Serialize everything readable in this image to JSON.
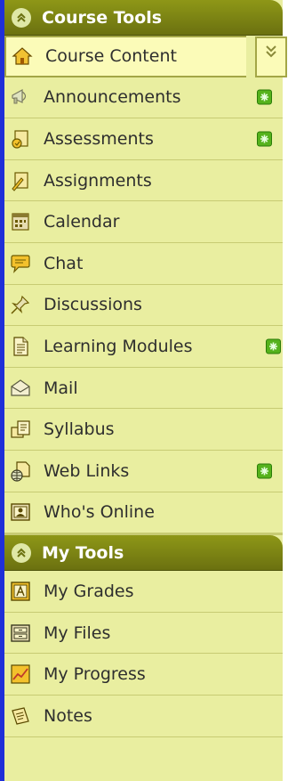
{
  "course_tools": {
    "title": "Course Tools",
    "items": [
      {
        "label": "Course Content",
        "icon": "home-icon",
        "active": true
      },
      {
        "label": "Announcements",
        "icon": "megaphone-icon",
        "badge": true
      },
      {
        "label": "Assessments",
        "icon": "assessment-icon",
        "badge": true
      },
      {
        "label": "Assignments",
        "icon": "assignment-icon"
      },
      {
        "label": "Calendar",
        "icon": "calendar-icon"
      },
      {
        "label": "Chat",
        "icon": "chat-bubble-icon"
      },
      {
        "label": "Discussions",
        "icon": "pushpin-icon"
      },
      {
        "label": "Learning Modules",
        "icon": "document-icon",
        "badge": true
      },
      {
        "label": "Mail",
        "icon": "envelope-icon"
      },
      {
        "label": "Syllabus",
        "icon": "syllabus-icon"
      },
      {
        "label": "Web Links",
        "icon": "globe-page-icon",
        "badge": true
      },
      {
        "label": "Who's Online",
        "icon": "user-monitor-icon"
      }
    ]
  },
  "my_tools": {
    "title": "My Tools",
    "items": [
      {
        "label": "My Grades",
        "icon": "grades-icon"
      },
      {
        "label": "My Files",
        "icon": "files-icon"
      },
      {
        "label": "My Progress",
        "icon": "progress-chart-icon"
      },
      {
        "label": "Notes",
        "icon": "notes-icon"
      }
    ]
  },
  "colors": {
    "header_bg": "#7d8414",
    "item_bg": "#e9eea0",
    "active_bg": "#fbfbb8",
    "badge": "#55b21c",
    "frame_border": "#1f2fd8"
  }
}
